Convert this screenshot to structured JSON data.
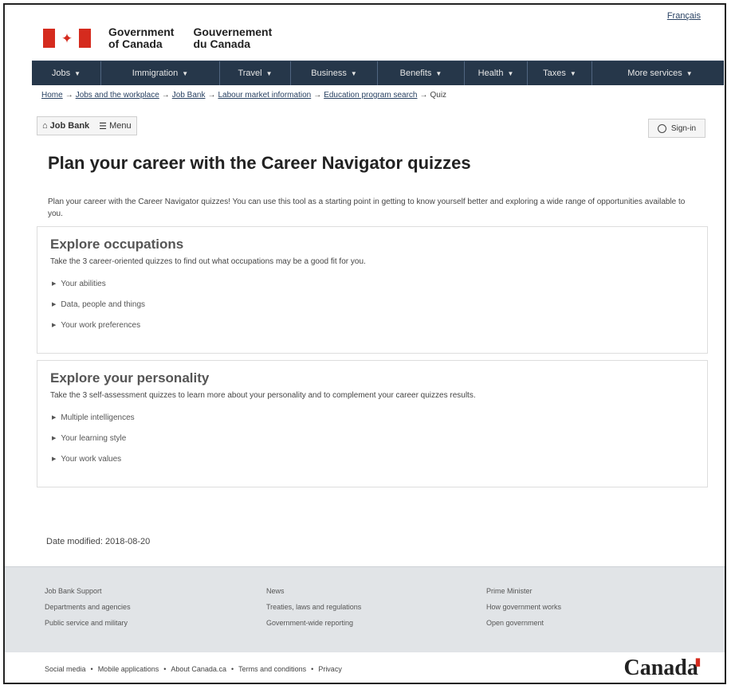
{
  "header": {
    "language_link": "Français",
    "gov_en_line1": "Government",
    "gov_en_line2": "of Canada",
    "gov_fr_line1": "Gouvernement",
    "gov_fr_line2": "du Canada"
  },
  "menu": {
    "items": [
      {
        "label": "Jobs"
      },
      {
        "label": "Immigration"
      },
      {
        "label": "Travel"
      },
      {
        "label": "Business"
      },
      {
        "label": "Benefits"
      },
      {
        "label": "Health"
      },
      {
        "label": "Taxes"
      },
      {
        "label": "More services"
      }
    ]
  },
  "breadcrumb": {
    "items": [
      "Home",
      "Jobs and the workplace",
      "Job Bank",
      "Labour market information",
      "Education program search"
    ],
    "current": "Quiz",
    "separator": "→"
  },
  "jobbank": {
    "home_label": "Job Bank",
    "menu_label": "Menu",
    "signin_label": "Sign-in"
  },
  "page": {
    "title": "Plan your career with the Career Navigator quizzes",
    "intro": "Plan your career with the Career Navigator quizzes! You can use this tool as a starting point in getting to know yourself better and exploring a wide range of opportunities available to you."
  },
  "panels": [
    {
      "title": "Explore occupations",
      "description": "Take the 3 career-oriented quizzes to find out what occupations may be a good fit for you.",
      "items": [
        "Your abilities",
        "Data, people and things",
        "Your work preferences"
      ]
    },
    {
      "title": "Explore your personality",
      "description": "Take the 3 self-assessment quizzes to learn more about your personality and to complement your career quizzes results.",
      "items": [
        "Multiple intelligences",
        "Your learning style",
        "Your work values"
      ]
    }
  ],
  "date_modified": "Date modified: 2018-08-20",
  "footer": {
    "col1": [
      "Job Bank Support",
      "Departments and agencies",
      "Public service and military"
    ],
    "col2": [
      "News",
      "Treaties, laws and regulations",
      "Government-wide reporting"
    ],
    "col3": [
      "Prime Minister",
      "How government works",
      "Open government"
    ],
    "bottom_links": [
      "Social media",
      "Mobile applications",
      "About Canada.ca",
      "Terms and conditions",
      "Privacy"
    ],
    "wordmark": "Canada"
  },
  "colors": {
    "menu_bg": "#26374a",
    "flag_red": "#d52b1e",
    "footer_bg": "#e1e4e7",
    "link": "#284162"
  },
  "icons": [
    "maple-leaf-icon",
    "chevron-down-icon",
    "arrow-right-icon",
    "home-icon",
    "hamburger-icon",
    "user-icon",
    "triangle-right-icon"
  ]
}
